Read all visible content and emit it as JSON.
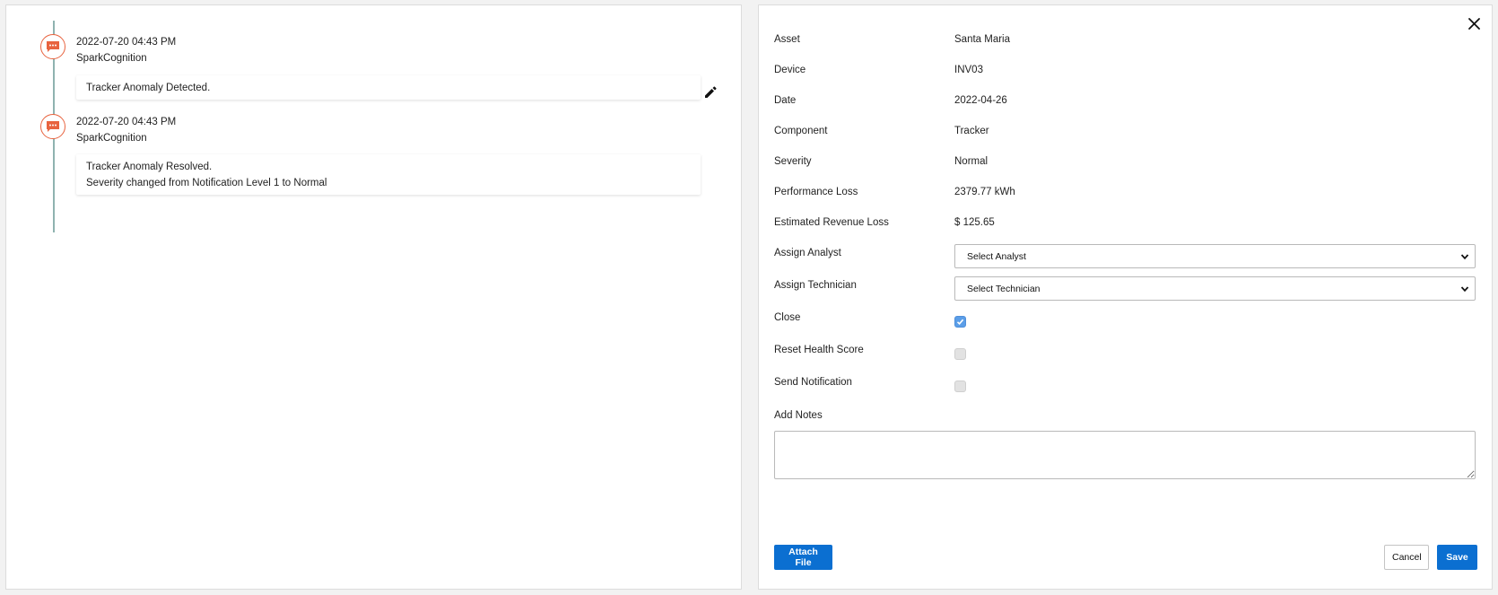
{
  "timeline": {
    "entries": [
      {
        "date": "2022-07-20 04:43 PM",
        "author": "SparkCognition",
        "lines": [
          "Tracker Anomaly Detected."
        ]
      },
      {
        "date": "2022-07-20 04:43 PM",
        "author": "SparkCognition",
        "lines": [
          "Tracker Anomaly Resolved.",
          "Severity changed from Notification Level 1 to Normal"
        ]
      }
    ],
    "accent_color": "#e8633f"
  },
  "details": {
    "asset": {
      "label": "Asset",
      "value": "Santa Maria"
    },
    "device": {
      "label": "Device",
      "value": "INV03"
    },
    "date": {
      "label": "Date",
      "value": "2022-04-26"
    },
    "component": {
      "label": "Component",
      "value": "Tracker"
    },
    "severity": {
      "label": "Severity",
      "value": "Normal"
    },
    "performance_loss": {
      "label": "Performance Loss",
      "value": "2379.77 kWh"
    },
    "revenue_loss": {
      "label": "Estimated Revenue Loss",
      "value": "$ 125.65"
    }
  },
  "form": {
    "assign_analyst": {
      "label": "Assign Analyst",
      "selected": "Select Analyst"
    },
    "assign_technician": {
      "label": "Assign Technician",
      "selected": "Select Technician"
    },
    "close": {
      "label": "Close",
      "checked": true
    },
    "reset_health_score": {
      "label": "Reset Health Score",
      "checked": false
    },
    "send_notification": {
      "label": "Send Notification",
      "checked": false
    },
    "notes": {
      "label": "Add Notes",
      "value": ""
    }
  },
  "buttons": {
    "attach": "Attach File",
    "cancel": "Cancel",
    "save": "Save"
  },
  "colors": {
    "primary": "#0b6fd1",
    "checkbox_checked": "#5b9ee8",
    "timeline_line": "#8fb3b0"
  }
}
